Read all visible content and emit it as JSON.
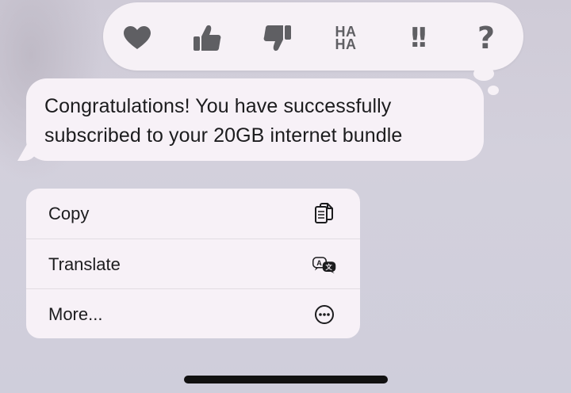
{
  "reactions": [
    {
      "name": "heart",
      "icon": "heart-icon"
    },
    {
      "name": "thumbs_up",
      "icon": "thumbs-up-icon"
    },
    {
      "name": "thumbs_down",
      "icon": "thumbs-down-icon"
    },
    {
      "name": "haha",
      "label_top": "HA",
      "label_bottom": "HA"
    },
    {
      "name": "emphasize",
      "label": "!!"
    },
    {
      "name": "question",
      "label": "?"
    }
  ],
  "message": {
    "text": "Congratulations! You have successfully subscribed to your 20GB internet bundle"
  },
  "menu": {
    "items": [
      {
        "label": "Copy",
        "icon": "copy-icon"
      },
      {
        "label": "Translate",
        "icon": "translate-icon"
      },
      {
        "label": "More...",
        "icon": "more-icon"
      }
    ]
  },
  "colors": {
    "background": "#cfcbd7",
    "bubble": "#f7f1f7",
    "icon": "#5f5f63",
    "text": "#1c1c1e"
  }
}
